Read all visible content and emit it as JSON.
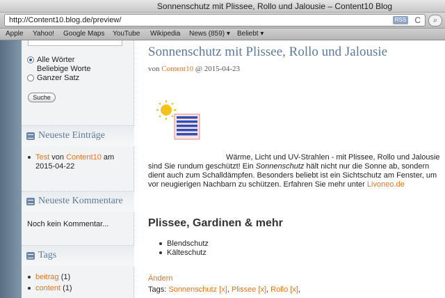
{
  "window": {
    "title": "Sonnenschutz mit Plissee, Rollo und Jalousie – Content10 Blog"
  },
  "toolbar": {
    "url": "http://Content10.blog.de/preview/",
    "rss_label": "RSS",
    "reload_glyph": "C"
  },
  "bookmarks": [
    {
      "label": "Apple"
    },
    {
      "label": "Yahoo!"
    },
    {
      "label": "Google Maps"
    },
    {
      "label": "YouTube"
    },
    {
      "label": "Wikipedia"
    },
    {
      "label": "News (859) ▾"
    },
    {
      "label": "Beliebt ▾"
    }
  ],
  "sidebar": {
    "search": {
      "options": [
        {
          "label": "Alle Wörter",
          "selected": true
        },
        {
          "label": "Beliebige Worte"
        },
        {
          "label": "Ganzer Satz",
          "selected": false
        }
      ],
      "button_label": "Suche"
    },
    "recent_posts": {
      "title": "Neueste Einträge",
      "item": {
        "link": "Test",
        "by": "von",
        "author": "Content10",
        "at": "am",
        "date": "2015-04-22"
      }
    },
    "recent_comments": {
      "title": "Neueste Kommentare",
      "empty_text": "Noch kein Kommentar..."
    },
    "tags": {
      "title": "Tags",
      "items": [
        {
          "name": "beitrag",
          "count": "(1)"
        },
        {
          "name": "content",
          "count": "(1)"
        }
      ]
    }
  },
  "post": {
    "title": "Sonnenschutz mit Plissee, Rollo und Jalousie",
    "byline_prefix": "von",
    "author": "Content10",
    "byline_date": "@ 2015-04-23",
    "paragraph_1": "Wärme, Licht und UV-Strahlen - mit Plissee, Rollo und Jalousie sind Sie rundum geschützt! Ein",
    "paragraph_em": "Sonnenschutz",
    "paragraph_2": "hält nicht nur die Sonne ab, sondern dient auch zum Schalldämpfen. Besonders beliebt ist ein Sichtschutz am Fenster, um vor neugierigen Nachbarn zu schützen. Erfahren Sie mehr unter",
    "paragraph_link": "Livoneo.de",
    "heading": "Plissee, Gardinen & mehr",
    "list": [
      "Blendschutz",
      "Kälteschutz"
    ],
    "edit_link": "Ändern",
    "tags_prefix": "Tags:",
    "tags": [
      "Sonnenschutz [x]",
      "Plissee [x]",
      "Rollo [x]"
    ]
  },
  "colors": {
    "link": "#e8731a",
    "heading": "#5d7a9a",
    "sun": "#f4c21c",
    "blinds": "#2f4fb4"
  }
}
